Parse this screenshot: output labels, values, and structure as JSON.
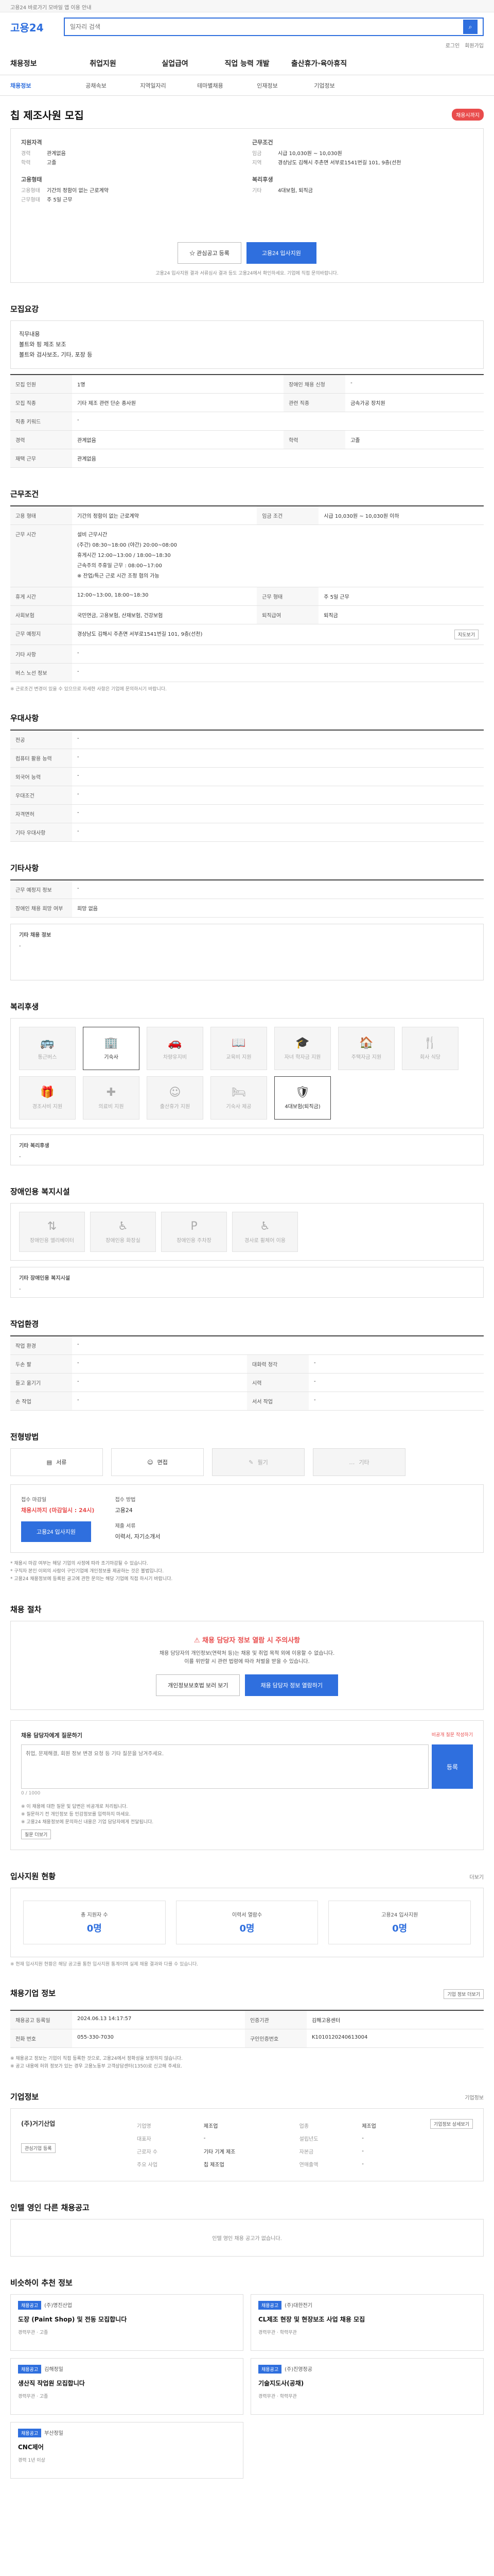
{
  "topbar": {
    "notice": "고용24 바로가기 모바일 앱 이용 안내"
  },
  "header": {
    "logo": "고용24",
    "search_placeholder": "일자리 검색",
    "util": [
      "로그인",
      "회원가입"
    ]
  },
  "gnb": [
    "채용정보",
    "취업지원",
    "실업급여",
    "직업 능력 개발",
    "출산휴가·육아휴직"
  ],
  "subnav": [
    "채용정보",
    "공채속보",
    "지역일자리",
    "테마별채용",
    "인재정보",
    "기업정보"
  ],
  "job": {
    "title": "칩 제조사원 모집",
    "status": "채용시까지",
    "company": {
      "heading": "지원자격",
      "rows": [
        {
          "k": "경력",
          "v": "관계없음"
        },
        {
          "k": "학력",
          "v": "고졸"
        }
      ]
    },
    "form": {
      "heading": "고용형태",
      "rows": [
        {
          "k": "고용형태",
          "v": "기간의 정함이 없는 근로계약"
        },
        {
          "k": "근무형태",
          "v": "주 5일 근무"
        }
      ]
    },
    "conditions": {
      "heading": "근무조건",
      "rows": [
        {
          "k": "임금",
          "v": "시급 10,030원 ~ 10,030원"
        },
        {
          "k": "지역",
          "v": "경상남도 김해시 주촌면 서부로1541번길 101, 9층(선천"
        }
      ]
    },
    "welfare": {
      "heading": "복리후생",
      "rows": [
        {
          "k": "기타",
          "v": "4대보험, 퇴직금"
        }
      ]
    },
    "btn_scrap": "관심공고 등록",
    "btn_apply": "고용24 입사지원",
    "summary_note": "고용24 입사지원 결과 서류심사 결과 등도 고용24에서 확인하세요. 기업에 직접 문의바랍니다."
  },
  "sections": {
    "recruit": {
      "title": "모집요강",
      "duty_label": "직무내용",
      "duty": [
        "볼트와 핑 제조 보조",
        "볼트와 검사보조, 기타, 포장 등"
      ],
      "rows": [
        {
          "k": "모집 인원",
          "v": "1명",
          "k2": "장애인 채용 신청",
          "v2": "-"
        },
        {
          "k": "모집 직종",
          "v": "기타 제조 관련 단순 종사원",
          "k2": "관련 직종",
          "v2": "금속가공 장치원"
        },
        {
          "k": "직종 키워드",
          "v": "-",
          "k2": "",
          "v2": ""
        },
        {
          "k": "경력",
          "v": "관계없음",
          "k2": "학력",
          "v2": "고졸"
        },
        {
          "k": "재택 근무",
          "v": "관계없음",
          "k2": "",
          "v2": ""
        }
      ]
    },
    "work": {
      "title": "근무조건",
      "type": "기간의 정함이 없는 근로계약",
      "wage": "시급 10,030원 ~ 10,030원 이하",
      "hours": [
        "설비 근무시간",
        "(주간) 08:30~18:00 (야간) 20:00~08:00",
        "휴게시간 12:00~13:00 / 18:00~18:30",
        "근속주의 주휴일 근무 : 08:00~17:00",
        "※ 잔업/특근 근로 시간 조정 협의 가능"
      ],
      "rows": [
        {
          "k": "휴게 시간",
          "v": "12:00~13:00, 18:00~18:30",
          "k2": "근무 형태",
          "v2": "주 5일 근무"
        },
        {
          "k": "사회보험",
          "v": "국민연금, 고용보험, 산재보험, 건강보험",
          "k2": "퇴직급여",
          "v2": "퇴직금"
        },
        {
          "k": "근무 예정지",
          "v": "경상남도 김해시 주촌면 서부로1541번길 101, 9층(선천)",
          "k2": "",
          "v2": ""
        },
        {
          "k": "기타 사항",
          "v": "-",
          "k2": "",
          "v2": ""
        },
        {
          "k": "버스 노선 정보",
          "v": "-",
          "k2": "",
          "v2": ""
        }
      ],
      "map_btn": "지도보기",
      "note": "※ 근로조건 변경이 있을 수 있으므로 자세한 사항은 기업에 문의하시기 바랍니다."
    },
    "pref": {
      "title": "우대사항",
      "rows": [
        {
          "k": "전공",
          "v": "-"
        },
        {
          "k": "컴퓨터 활용 능력",
          "v": "-"
        },
        {
          "k": "외국어 능력",
          "v": "-"
        },
        {
          "k": "우대조건",
          "v": "-"
        },
        {
          "k": "자격면허",
          "v": "-"
        },
        {
          "k": "기타 우대사항",
          "v": "-"
        }
      ]
    },
    "other": {
      "title": "기타사항",
      "rows": [
        {
          "k": "근무 예정지 정보",
          "v": "-"
        },
        {
          "k": "장애인 채용 희망 여부",
          "v": "희망 없음"
        }
      ],
      "box_title": "기타 채용 정보",
      "box_value": "-"
    },
    "welfare": {
      "title": "복리후생",
      "items": [
        {
          "label": "통근버스",
          "icon": "bus-icon",
          "on": false
        },
        {
          "label": "기숙사",
          "icon": "building-icon",
          "on": true
        },
        {
          "label": "차량유지비",
          "icon": "car-icon",
          "on": false
        },
        {
          "label": "교육비 지원",
          "icon": "book-icon",
          "on": false
        },
        {
          "label": "자녀 학자금 지원",
          "icon": "graduation-icon",
          "on": false
        },
        {
          "label": "주택자금 지원",
          "icon": "house-icon",
          "on": false
        },
        {
          "label": "회사 식당",
          "icon": "utensils-icon",
          "on": false
        },
        {
          "label": "경조사비 지원",
          "icon": "gift-icon",
          "on": false
        },
        {
          "label": "의료비 지원",
          "icon": "medical-icon",
          "on": false
        },
        {
          "label": "출산휴가 지원",
          "icon": "baby-icon",
          "on": false
        },
        {
          "label": "기숙사 제공",
          "icon": "bed-icon",
          "on": false
        },
        {
          "label": "4대보험(퇴직금)",
          "icon": "shield-icon",
          "on": true
        }
      ],
      "box_title": "기타 복리후생",
      "box_value": "-"
    },
    "access": {
      "title": "장애인용 복지시설",
      "items": [
        {
          "label": "장애인용 엘리베이터",
          "icon": "elevator-icon"
        },
        {
          "label": "장애인용 화장실",
          "icon": "restroom-icon"
        },
        {
          "label": "장애인용 주차장",
          "icon": "parking-icon"
        },
        {
          "label": "경사로 휠체어 이용",
          "icon": "wheelchair-icon"
        }
      ],
      "box_title": "기타 장애인용 복지시설",
      "box_value": "-"
    },
    "env": {
      "title": "작업환경",
      "rows": [
        {
          "k": "작업 환경",
          "v": "-",
          "k2": "",
          "v2": ""
        },
        {
          "k": "두손 팔",
          "v": "-",
          "k2": "대화력 청각",
          "v2": "-"
        },
        {
          "k": "들고 옮기기",
          "v": "-",
          "k2": "시력",
          "v2": "-"
        },
        {
          "k": "손 작업",
          "v": "-",
          "k2": "서서 작업",
          "v2": "-"
        }
      ]
    },
    "process": {
      "title": "전형방법",
      "steps": [
        {
          "label": "서류",
          "icon": "doc-icon",
          "on": true
        },
        {
          "label": "면접",
          "icon": "person-icon",
          "on": true
        },
        {
          "label": "필기",
          "icon": "pencil-icon",
          "on": false
        },
        {
          "label": "기타",
          "icon": "etc-icon",
          "on": false
        }
      ],
      "deadline_label": "접수 마감일",
      "deadline": "채용시까지 (마감일시 : 24시)",
      "method_label": "접수 방법",
      "method": "고용24",
      "docs_label": "제출 서류",
      "docs": "이력서, 자기소개서",
      "apply_btn": "고용24 입사지원",
      "notes": [
        "* 채용시 마감 여부는 해당 기업의 사정에 따라 조기마감될 수 있습니다.",
        "* 구직자 본인 이외의 사람이 구인기업에 개인정보를 제공하는 것은 불법입니다.",
        "* 고용24 채용정보에 등록된 공고에 관한 문의는 해당 기업에 직접 하시기 바랍니다."
      ]
    },
    "ban": {
      "title": "채용 절차",
      "box_title": "채용 담당자 정보 열람 시 주의사항",
      "lines": [
        "채용 담당자의 개인정보(연락처 등)는 채용 및 취업 목적 외에 이용할 수 없습니다.",
        "이를 위반할 시 관련 법령에 따라 처벌을 받을 수 있습니다."
      ],
      "btn1": "개인정보보호법 보러 보기",
      "btn2": "채용 담당자 정보 열람하기",
      "qa_title": "채용 담당자에게 질문하기",
      "qa_hint": "비공개 질문 작성하기",
      "qa_placeholder": "취업, 문제해결, 회원 정보 변경 요청 등 기타 질문을 남겨주세요.",
      "qa_btn": "등록",
      "qa_counter": "0 / 1000",
      "notes": [
        "※ 이 채용에 대한 질문 및 답변은 비공개로 처리됩니다.",
        "※ 질문하기 전 개인정보 등 민감정보를 입력하지 마세요.",
        "※ 고용24 채용정보에 문의하신 내용은 기업 담당자에게 전달됩니다."
      ],
      "more_btn": "질문 더보기"
    },
    "stat": {
      "title": "입사지원 현황",
      "more": "더보기",
      "items": [
        {
          "label": "총 지원자 수",
          "value": "0명"
        },
        {
          "label": "이력서 열람수",
          "value": "0명"
        },
        {
          "label": "고용24 입사지원",
          "value": "0명"
        }
      ],
      "note": "※ 현재 입사지원 현황은 해당 공고를 통한 입사지원 통계이며 실제 채용 결과와 다를 수 있습니다."
    },
    "info": {
      "title": "채용기업 정보",
      "btn": "기업 정보 더보기",
      "rows": [
        {
          "k": "채용공고 등록일",
          "v": "2024.06.13 14:17:57",
          "k2": "인증기관",
          "v2": "김해고용센터"
        },
        {
          "k": "전화 번호",
          "v": "055-330-7030",
          "k2": "구인인증번호",
          "v2": "K1010120240613004"
        }
      ],
      "notes": [
        "※ 채용공고 정보는 기업이 직접 등록한 것으로, 고용24에서 정확성을 보장하지 않습니다.",
        "※ 공고 내용에 허위 정보가 있는 경우 고용노동부 고객상담센터(1350)로 신고해 주세요."
      ]
    },
    "company": {
      "title": "기업정보",
      "more": "기업정보",
      "name": "(주)거기산업",
      "rows": [
        {
          "k": "기업명",
          "v": "제조업",
          "k2": "업종",
          "v2": "제조업"
        },
        {
          "k": "대표자",
          "v": "-",
          "k2": "설립년도",
          "v2": "-"
        },
        {
          "k": "근로자 수",
          "v": "기타 기계 제조",
          "k2": "자본금",
          "v2": "-"
        },
        {
          "k": "주요 사업",
          "v": "칩 제조업",
          "k2": "연매출액",
          "v2": "-"
        }
      ],
      "btn1": "관심기업 등록",
      "btn2": "기업정보 상세보기"
    },
    "related": {
      "title": "인텔 영인 다른 채용공고",
      "empty": "인텔 영인 채용 공고가 없습니다."
    },
    "similar": {
      "title": "비슷하이 추천 정보",
      "cards": [
        {
          "tag": "채용공고",
          "company": "(주)명진산업",
          "job": "도장 (Paint Shop) 및 전동 모집합니다",
          "meta": "경력무관 · 고졸"
        },
        {
          "tag": "채용공고",
          "company": "(주)대한전기",
          "job": "CL제조 현장 및 현장보조 사업 채용 모집",
          "meta": "경력무관 · 학력무관"
        },
        {
          "tag": "채용공고",
          "company": "김해정밀",
          "job": "생산직 작업원 모집합니다",
          "meta": "경력무관 · 고졸"
        },
        {
          "tag": "채용공고",
          "company": "(주)진영정공",
          "job": "기술지도사(공채)",
          "meta": "경력무관 · 학력무관"
        },
        {
          "tag": "채용공고",
          "company": "부산정밀",
          "job": "CNC제어",
          "meta": "경력 1년 이상"
        }
      ]
    }
  }
}
